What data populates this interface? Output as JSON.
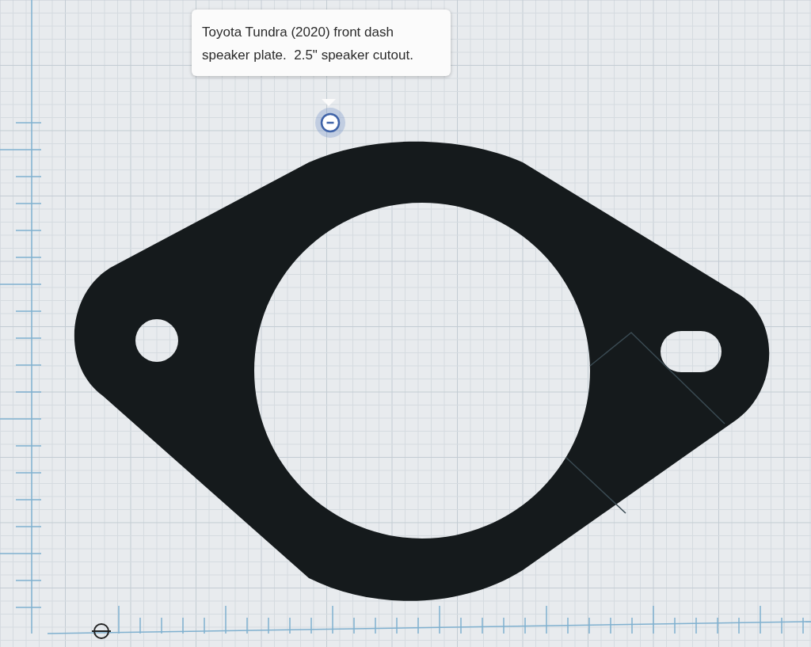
{
  "note": {
    "text": "Toyota Tundra (2020) front dash speaker plate.  2.5\" speaker cutout."
  }
}
